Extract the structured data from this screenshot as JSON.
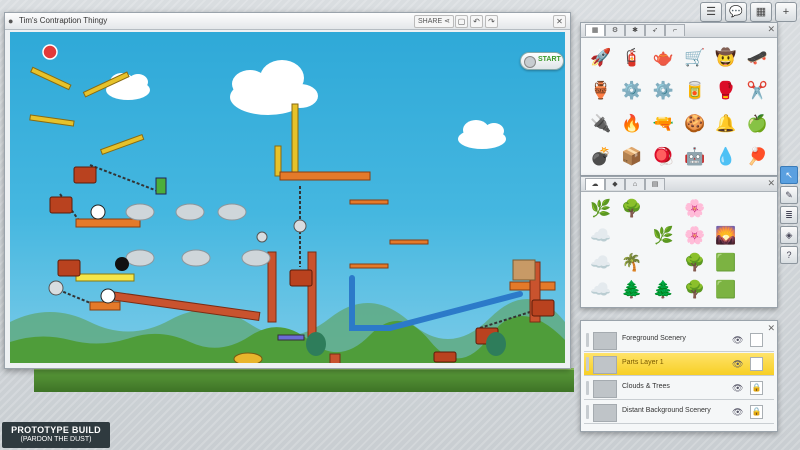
{
  "editor": {
    "title": "Tim's Contraption Thingy",
    "share_label": "SHARE",
    "start_label": "START"
  },
  "top_toolbar": {
    "icons": [
      "list-icon",
      "chat-icon",
      "grid-icon",
      "plus-icon",
      "menu-icon"
    ]
  },
  "parts_panel": {
    "tabs": [
      "grid-icon",
      "gear-icon",
      "settings-icon",
      "rocket-icon",
      "gun-icon"
    ],
    "items": [
      "🚀",
      "🧯",
      "🫖",
      "🛒",
      "🤠",
      "🛹",
      "🏺",
      "⚙️",
      "⚙️",
      "🥫",
      "🥊",
      "✂️",
      "🔌",
      "🔥",
      "🔫",
      "🍪",
      "🔔",
      "🍏",
      "💣",
      "📦",
      "🪀",
      "🤖",
      "💧",
      "🏓"
    ]
  },
  "scenery_panel": {
    "tabs": [
      "cloud-icon",
      "rock-icon",
      "house-icon",
      "building-icon"
    ],
    "items": [
      "🌿",
      "🌳",
      "",
      "🌸",
      "",
      "",
      "☁️",
      "",
      "🌿",
      "🌸",
      "🌄",
      "",
      "☁️",
      "🌴",
      "",
      "🌳",
      "🟩",
      "",
      "☁️",
      "🌲",
      "🌲",
      "🌳",
      "🟩",
      ""
    ]
  },
  "layers": [
    {
      "name": "Foreground Scenery",
      "active": false
    },
    {
      "name": "Parts Layer 1",
      "active": true
    },
    {
      "name": "Clouds & Trees",
      "active": false
    },
    {
      "name": "Distant Background Scenery",
      "active": false
    }
  ],
  "side_tools": [
    "cursor-icon",
    "pencil-icon",
    "layers-icon",
    "cube-icon",
    "help-icon"
  ],
  "prototype": {
    "line1": "PROTOTYPE BUILD",
    "line2": "(PARDON THE DUST)"
  },
  "colors": {
    "sky": "#2fa9d8",
    "grass": "#4f9d3a",
    "brick": "#c9532e",
    "belt": "#2c7ac9",
    "active_layer": "#f7cf25"
  }
}
